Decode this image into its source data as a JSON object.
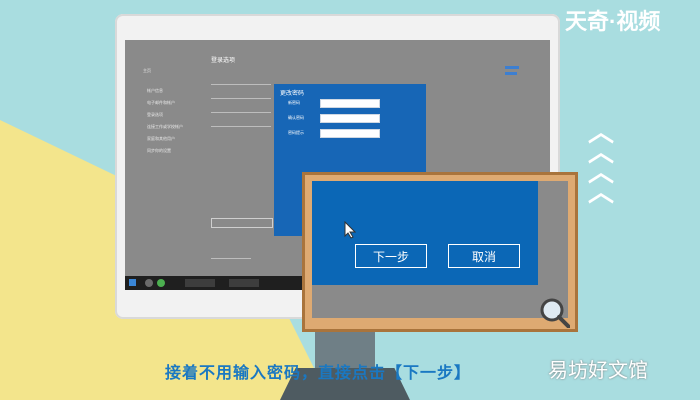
{
  "watermarks": {
    "top_right": "天奇·视频",
    "bottom_right": "易坊好文馆"
  },
  "caption": "接着不用输入密码，直接点击【下一步】",
  "settings": {
    "section_title": "登录选项",
    "sidebar_items": [
      "主页",
      "帐户信息",
      "电子邮件和帐户",
      "登录选项",
      "连接工作或学校帐户",
      "家庭和其他用户",
      "同步你的设置"
    ]
  },
  "password_dialog": {
    "title": "更改密码",
    "fields": [
      {
        "label": "新密码",
        "value": ""
      },
      {
        "label": "确认密码",
        "value": ""
      },
      {
        "label": "密码提示",
        "value": ""
      }
    ]
  },
  "board": {
    "next_label": "下一步",
    "cancel_label": "取消"
  },
  "colors": {
    "accent_blue": "#0b67b6",
    "board_wood": "#deaa72",
    "background_teal": "#a9dde0",
    "background_yellow": "#f3e58c"
  }
}
